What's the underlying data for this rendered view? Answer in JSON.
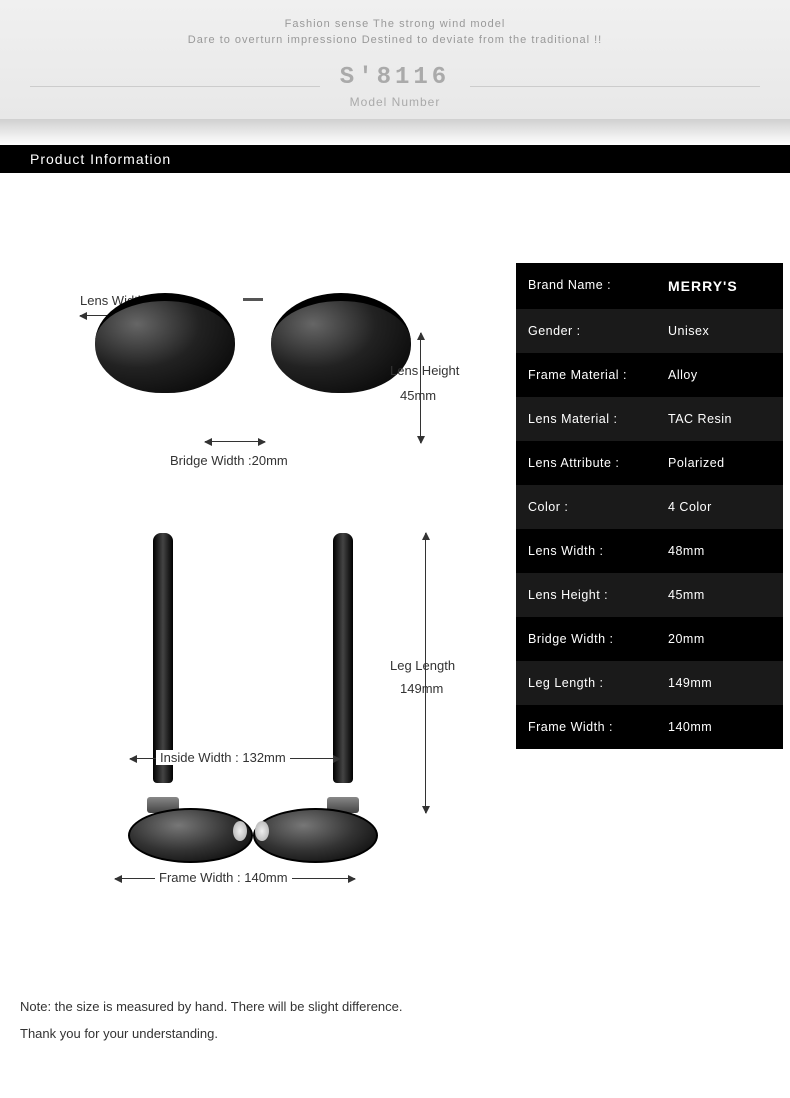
{
  "header": {
    "tagline1": "Fashion sense The strong wind model",
    "tagline2": "Dare to overturn impressiono Destined to deviate from the traditional !!",
    "model_number": "S'8116",
    "model_label": "Model Number"
  },
  "section_title": "Product Information",
  "diagram": {
    "lens_width": "Lens Width :48mm",
    "bridge_width": "Bridge Width :20mm",
    "lens_height_label": "Lens Height",
    "lens_height_value": "45mm",
    "leg_length_label": "Leg Length",
    "leg_length_value": "149mm",
    "inside_width": "Inside  Width :  132mm",
    "frame_width": "Frame Width :  140mm"
  },
  "specs": [
    {
      "label": "Brand Name :",
      "value": "MERRY'S",
      "is_brand": true
    },
    {
      "label": "Gender :",
      "value": "Unisex"
    },
    {
      "label": "Frame Material :",
      "value": "Alloy"
    },
    {
      "label": "Lens Material :",
      "value": "TAC Resin"
    },
    {
      "label": "Lens Attribute :",
      "value": "Polarized"
    },
    {
      "label": "Color :",
      "value": "4 Color"
    },
    {
      "label": "Lens Width :",
      "value": "48mm"
    },
    {
      "label": "Lens Height :",
      "value": "45mm"
    },
    {
      "label": "Bridge Width :",
      "value": "20mm"
    },
    {
      "label": "Leg Length :",
      "value": "149mm"
    },
    {
      "label": "Frame Width :",
      "value": "140mm"
    }
  ],
  "note": {
    "line1": "Note: the size is measured by hand. There will be slight difference.",
    "line2": "Thank you for your understanding."
  }
}
